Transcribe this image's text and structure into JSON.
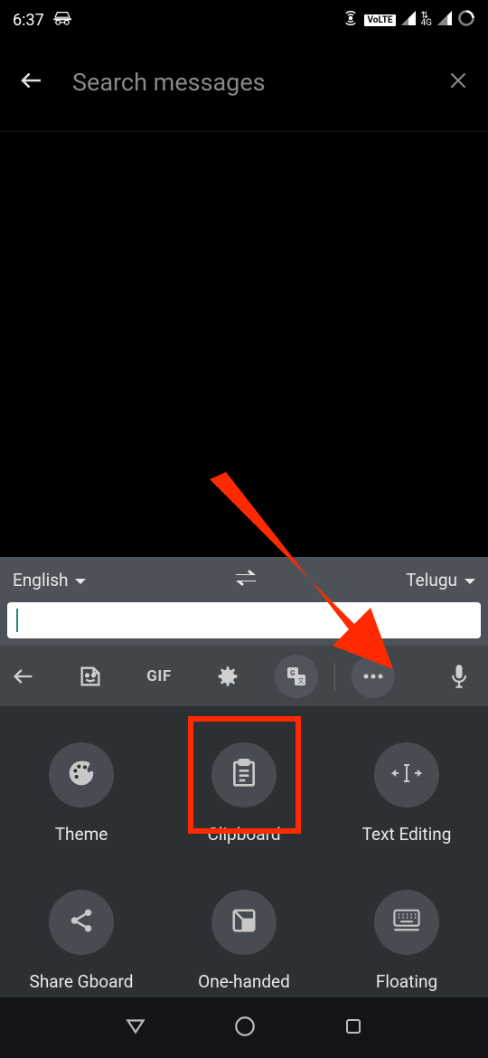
{
  "status": {
    "time": "6:37",
    "volte": "VoLTE",
    "network": "4G"
  },
  "search": {
    "placeholder": "Search messages"
  },
  "translate": {
    "source": "English",
    "target": "Telugu"
  },
  "strip": {
    "gif_label": "GIF"
  },
  "options": {
    "theme": "Theme",
    "clipboard": "Clipboard",
    "text_editing": "Text Editing",
    "share_gboard": "Share Gboard",
    "one_handed": "One-handed",
    "floating": "Floating"
  },
  "highlight": {
    "target": "clipboard"
  }
}
